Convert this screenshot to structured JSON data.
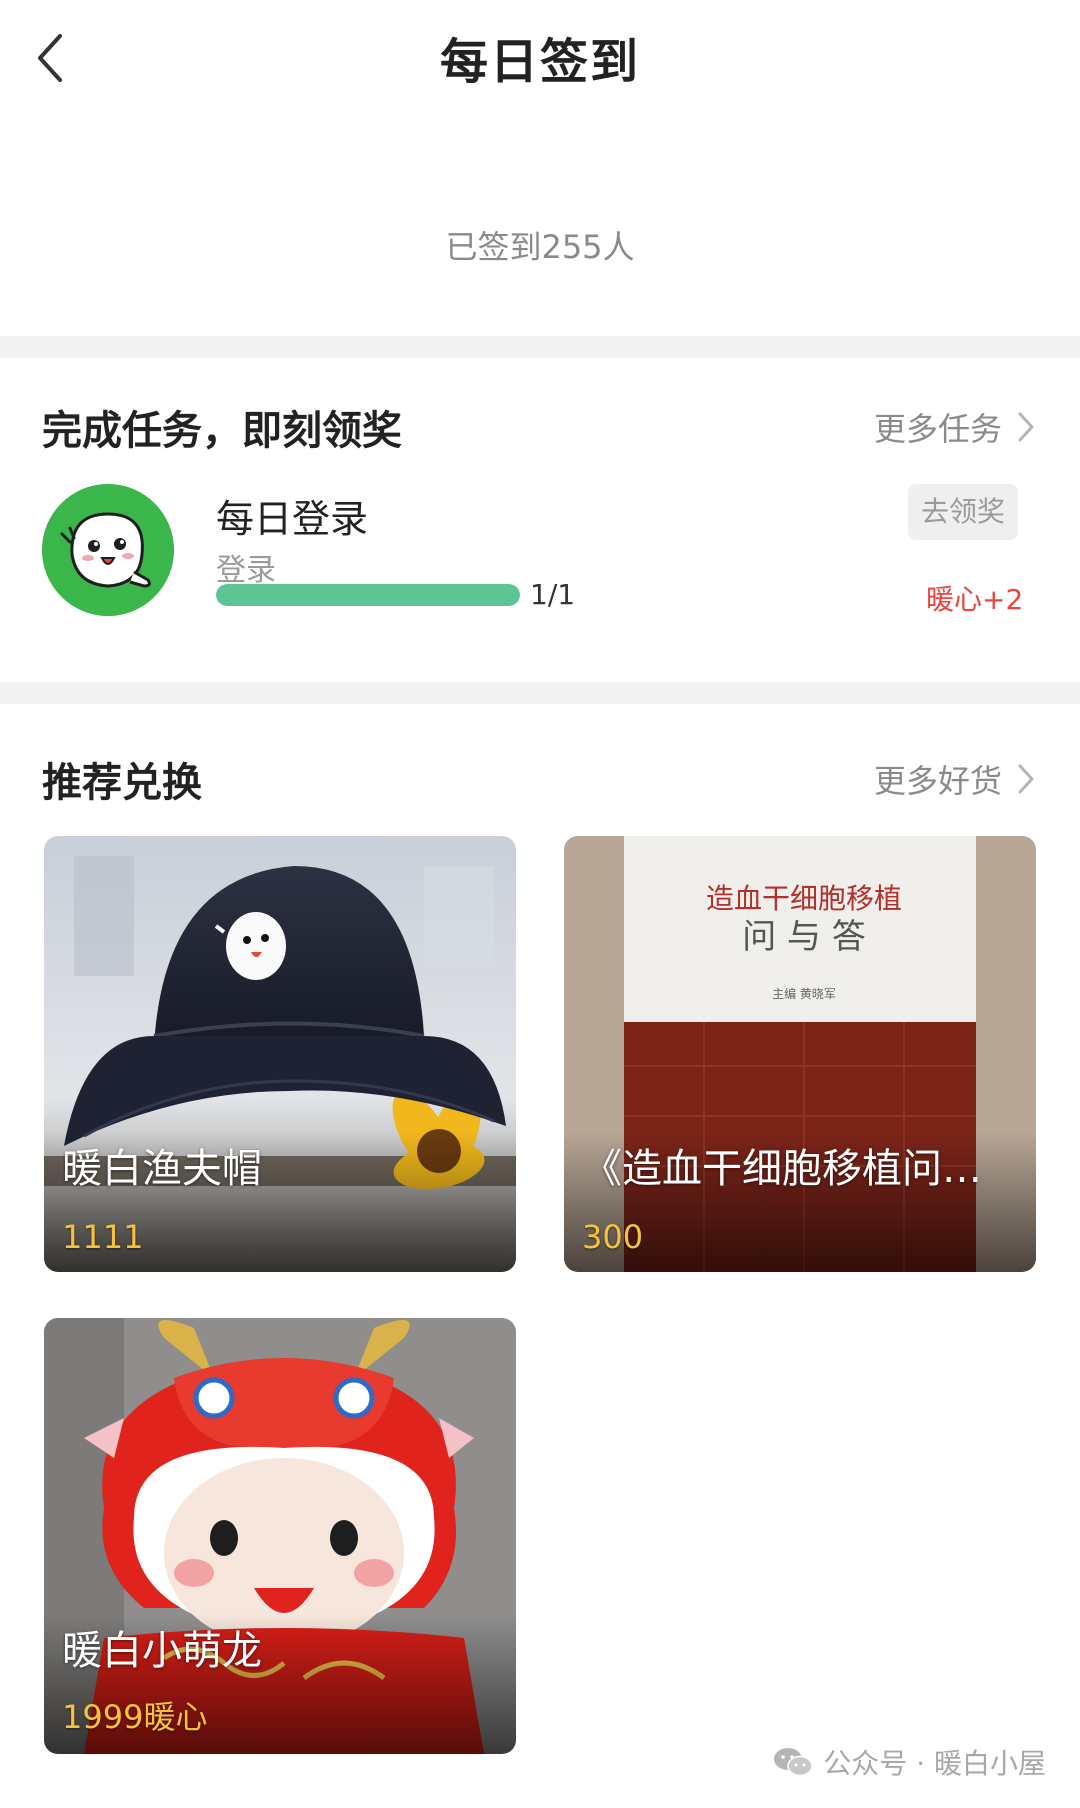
{
  "header": {
    "title": "每日签到",
    "back_icon": "chevron-left-icon"
  },
  "signin": {
    "count_text": "已签到255人"
  },
  "tasks": {
    "title": "完成任务，即刻领奖",
    "more_label": "更多任务",
    "items": [
      {
        "name": "每日登录",
        "subtitle": "登录",
        "progress": 1.0,
        "progress_text": "1/1",
        "button_label": "去领奖",
        "reward_text": "暖心+2"
      }
    ]
  },
  "exchange": {
    "title": "推荐兑换",
    "more_label": "更多好货",
    "items": [
      {
        "name": "暖白渔夫帽",
        "price": "1111"
      },
      {
        "name": "《造血干细胞移植问与答》",
        "price": "300",
        "book_title_line1": "造血干细胞移植",
        "book_title_line2": "问 与 答",
        "book_editor": "主编  黄晓军"
      },
      {
        "name": "暖白小萌龙",
        "price": "1999暖心"
      }
    ]
  },
  "watermark": {
    "text": "公众号 · 暖白小屋",
    "icon": "wechat-icon"
  },
  "colors": {
    "progress": "#5cc594",
    "reward": "#e8453c",
    "price": "#f5c33b",
    "brand_green": "#3ab64a"
  }
}
